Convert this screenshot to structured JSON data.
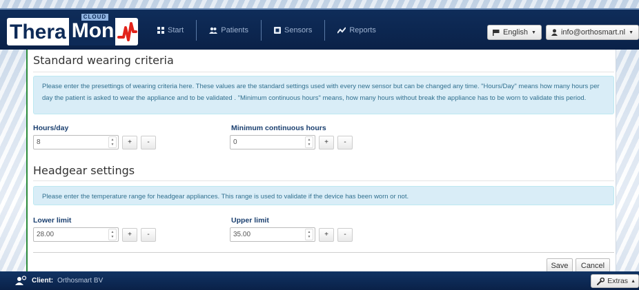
{
  "app": {
    "logo_thera": "Thera",
    "logo_mon": "Mon",
    "logo_cloud": "CLOUD"
  },
  "nav": {
    "items": [
      {
        "label": "Start",
        "icon": "grid-icon"
      },
      {
        "label": "Patients",
        "icon": "users-icon"
      },
      {
        "label": "Sensors",
        "icon": "sensor-icon"
      },
      {
        "label": "Reports",
        "icon": "chart-line-icon"
      }
    ]
  },
  "header": {
    "language": "English",
    "user": "info@orthosmart.nl"
  },
  "wearing": {
    "title": "Standard wearing criteria",
    "info": "Please enter the presettings of wearing criteria here. These values are the standard settings used with every new sensor but can be changed any time. \"Hours/Day\" means how many hours per day the patient is asked to wear the appliance and to be validated . \"Minimum continuous hours\" means, how many hours without break the appliance has to be worn to validate this period.",
    "hours_label": "Hours/day",
    "hours_value": "8",
    "min_label": "Minimum continuous hours",
    "min_value": "0"
  },
  "headgear": {
    "title": "Headgear settings",
    "info": "Please enter the temperature range for headgear appliances. This range is used to validate if the device has been worn or not.",
    "lower_label": "Lower limit",
    "lower_value": "28.00",
    "upper_label": "Upper limit",
    "upper_value": "35.00"
  },
  "stepper": {
    "plus": "+",
    "minus": "-"
  },
  "actions": {
    "save": "Save",
    "cancel": "Cancel"
  },
  "footer": {
    "client_label": "Client:",
    "client_name": "Orthosmart BV",
    "extras": "Extras"
  }
}
